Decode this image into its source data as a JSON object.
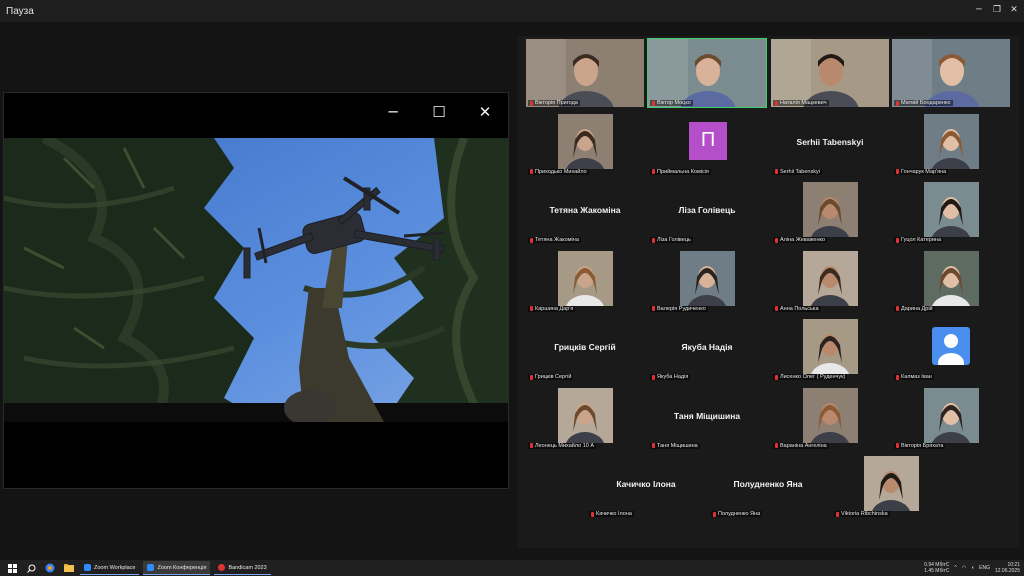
{
  "window": {
    "title": "Пауза"
  },
  "gallery": {
    "rows": [
      [
        {
          "name": "Вікторія Пригода",
          "type": "video"
        },
        {
          "name": "Віктор Моцко",
          "type": "video",
          "active": true
        },
        {
          "name": "Наталія Мацкевич",
          "type": "video"
        },
        {
          "name": "Матвій Бондаренко",
          "type": "video"
        }
      ],
      [
        {
          "name": "Приходько Михайло",
          "type": "photo"
        },
        {
          "name": "Приймальна Комісія",
          "type": "initial",
          "initial": "П"
        },
        {
          "name": "Serhii Tabenskyi",
          "type": "text",
          "display": "Serhii Tabenskyi"
        },
        {
          "name": "Гончарук Мар'яна",
          "type": "photo"
        }
      ],
      [
        {
          "name": "Тетяна Жакоміна",
          "type": "text",
          "display": "Тетяна Жакоміна"
        },
        {
          "name": "Ліза Голівець",
          "type": "text",
          "display": "Ліза Голівець"
        },
        {
          "name": "Аліна Жеваженко",
          "type": "photo"
        },
        {
          "name": "Гуцол Катерина",
          "type": "photo"
        }
      ],
      [
        {
          "name": "Каршина Дар'я",
          "type": "photo"
        },
        {
          "name": "Валерія Рудиченко",
          "type": "photo"
        },
        {
          "name": "Анна Польська",
          "type": "photo"
        },
        {
          "name": "Дарина Дрій",
          "type": "photo"
        }
      ],
      [
        {
          "name": "Грицків Сергій",
          "type": "text",
          "display": "Грицків Сергій"
        },
        {
          "name": "Якуба Надія",
          "type": "text",
          "display": "Якуба Надія"
        },
        {
          "name": "Лисенко Олег ( Руденчук)",
          "type": "photo"
        },
        {
          "name": "Калмаз Іван",
          "type": "avatar"
        }
      ],
      [
        {
          "name": "Леонець Михайло 10 А",
          "type": "photo"
        },
        {
          "name": "Таня Міщишина",
          "type": "text",
          "display": "Таня Міщишина"
        },
        {
          "name": "Вараніна Ангеліна",
          "type": "photo"
        },
        {
          "name": "Вікторія Бряхата",
          "type": "photo"
        }
      ],
      [
        {
          "name": "Качичко Ілона",
          "type": "text",
          "display": "Качичко Ілона"
        },
        {
          "name": "Полудненко Яна",
          "type": "text",
          "display": "Полудненко Яна"
        },
        {
          "name": "Viktoria Ribchinska",
          "type": "photo"
        }
      ]
    ]
  },
  "taskbar": {
    "apps": [
      {
        "label": "Zoom Workplace",
        "active": false
      },
      {
        "label": "Zoom Конференція",
        "active": true
      },
      {
        "label": "Bandicam 2023",
        "active": false
      }
    ],
    "net_up": "0.94 МбітС",
    "net_down": "1.45 МбітС",
    "lang": "ENG",
    "time": "10:21",
    "date": "12.06.2025"
  }
}
